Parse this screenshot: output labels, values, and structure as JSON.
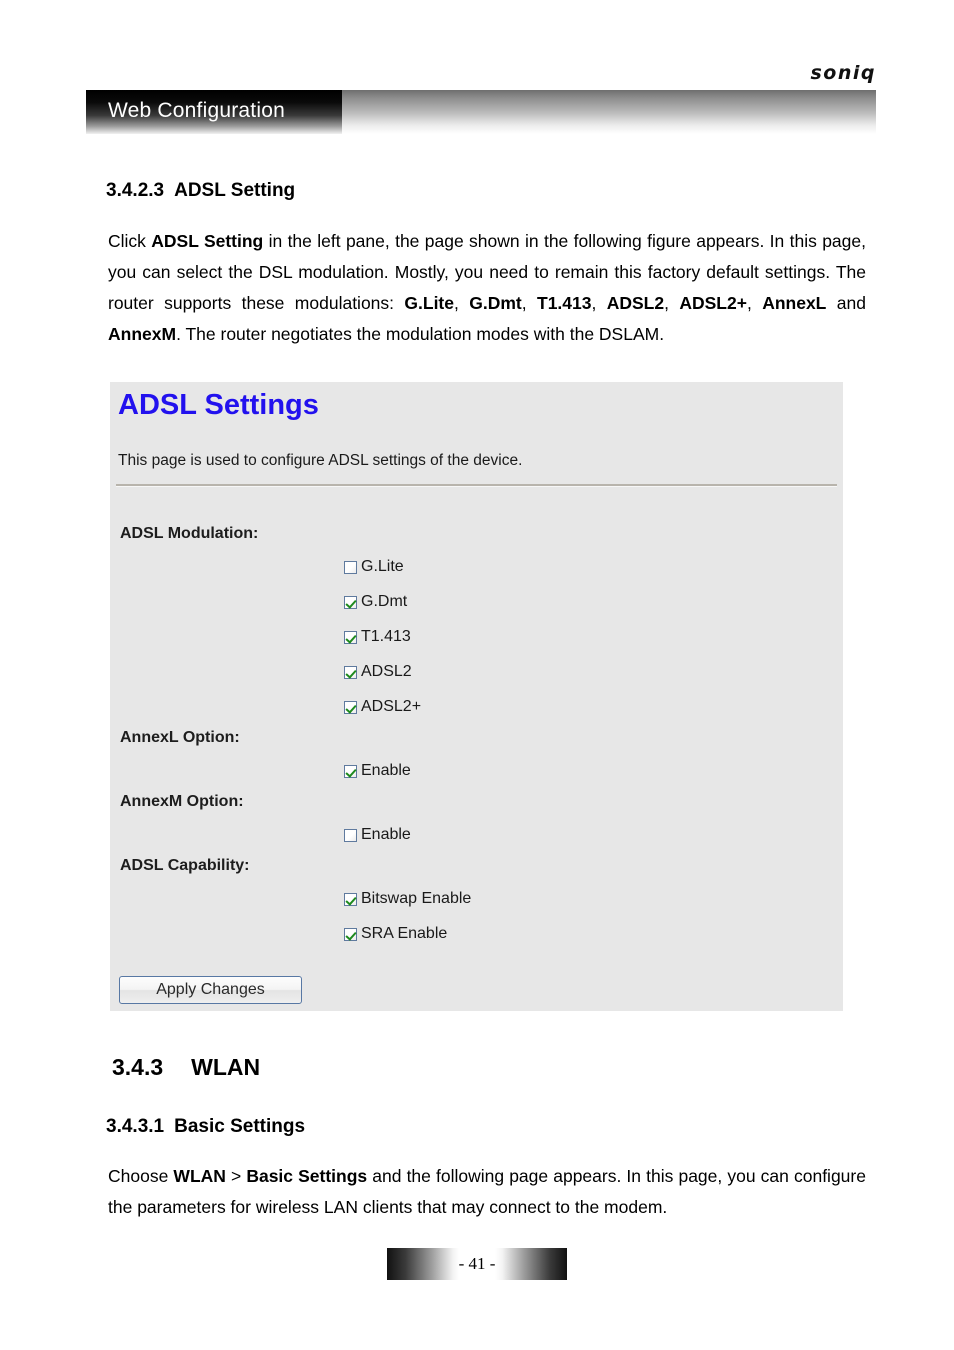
{
  "brand": {
    "logo_text": "soniq"
  },
  "banner": {
    "title": "Web Configuration"
  },
  "headings": {
    "adsl_setting": {
      "number": "3.4.2.3",
      "title": "ADSL Setting"
    },
    "wlan": {
      "number": "3.4.3",
      "title": "WLAN"
    },
    "basic_settings": {
      "number": "3.4.3.1",
      "title": "Basic Settings"
    }
  },
  "paragraphs": {
    "adsl_intro_html": "Click <b>ADSL Setting</b> in the left pane, the page shown in the following figure appears. In this page, you can select the DSL modulation. Mostly, you need to remain this factory default settings. The router supports these modulations: <b>G.Lite</b>, <b>G.Dmt</b>, <b>T1.413</b>, <b>ADSL2</b>, <b>ADSL2+</b>, <b>AnnexL</b> and <b>AnnexM</b>. The router negotiates the modulation modes with the DSLAM.",
    "basic_intro_html": "Choose <b>WLAN</b> &gt; <b>Basic Settings</b> and the following page appears. In this page, you can configure the parameters for wireless LAN clients that may connect to the modem."
  },
  "figure": {
    "title": "ADSL Settings",
    "title_color": "#2211ee",
    "description": "This page is used to configure ADSL settings of the device.",
    "background_color": "#e7e7e7",
    "sections": [
      {
        "label": "ADSL Modulation:",
        "options": [
          {
            "label": "G.Lite",
            "checked": false
          },
          {
            "label": "G.Dmt",
            "checked": true
          },
          {
            "label": "T1.413",
            "checked": true
          },
          {
            "label": "ADSL2",
            "checked": true
          },
          {
            "label": "ADSL2+",
            "checked": true
          }
        ]
      },
      {
        "label": "AnnexL Option:",
        "options": [
          {
            "label": "Enable",
            "checked": true
          }
        ]
      },
      {
        "label": "AnnexM Option:",
        "options": [
          {
            "label": "Enable",
            "checked": false
          }
        ]
      },
      {
        "label": "ADSL Capability:",
        "options": [
          {
            "label": "Bitswap Enable",
            "checked": true
          },
          {
            "label": "SRA Enable",
            "checked": true
          }
        ]
      }
    ],
    "apply_button": "Apply Changes"
  },
  "footer": {
    "page_number": "- 41 -"
  }
}
